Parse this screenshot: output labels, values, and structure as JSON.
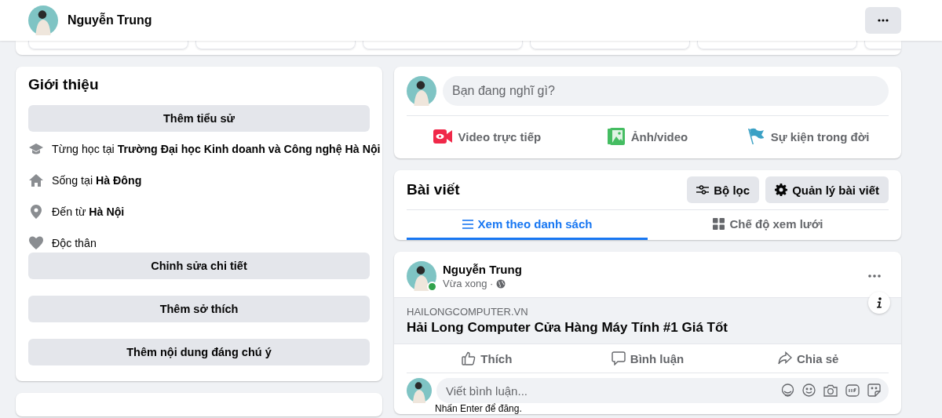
{
  "header": {
    "name": "Nguyễn Trung"
  },
  "intro": {
    "title": "Giới thiệu",
    "add_bio": "Thêm tiểu sử",
    "items": [
      {
        "kind": "school",
        "text": "Từng học tại **Trường Đại học Kinh doanh và Công nghệ Hà Nội**"
      },
      {
        "kind": "home",
        "text": "Sống tại **Hà Đông**"
      },
      {
        "kind": "location",
        "text": "Đến từ **Hà Nội**"
      },
      {
        "kind": "heart",
        "text": "Độc thân"
      }
    ],
    "buttons": [
      "Chỉnh sửa chi tiết",
      "Thêm sở thích",
      "Thêm nội dung đáng chú ý"
    ]
  },
  "composer": {
    "placeholder": "Bạn đang nghĩ gì?",
    "actions": [
      {
        "kind": "video",
        "label": "Video trực tiếp"
      },
      {
        "kind": "photo",
        "label": "Ảnh/video"
      },
      {
        "kind": "flag",
        "label": "Sự kiện trong đời"
      }
    ]
  },
  "posts": {
    "title": "Bài viết",
    "filter": "Bộ lọc",
    "manage": "Quản lý bài viết",
    "tabs": [
      {
        "kind": "list",
        "label": "Xem theo danh sách",
        "selected": true
      },
      {
        "kind": "grid",
        "label": "Chế độ xem lưới",
        "selected": false
      }
    ]
  },
  "post": {
    "author": "Nguyễn Trung",
    "online": true,
    "time": "Vừa xong ·",
    "link_domain": "HAILONGCOMPUTER.VN",
    "link_title": "Hải Long Computer Cửa Hàng Máy Tính #1 Giá Tốt",
    "actions": [
      {
        "kind": "like",
        "label": "Thích"
      },
      {
        "kind": "comment",
        "label": "Bình luận"
      },
      {
        "kind": "share",
        "label": "Chia sẻ"
      }
    ],
    "comment_placeholder": "Viết bình luận...",
    "comment_hint": "Nhấn Enter để đăng."
  }
}
